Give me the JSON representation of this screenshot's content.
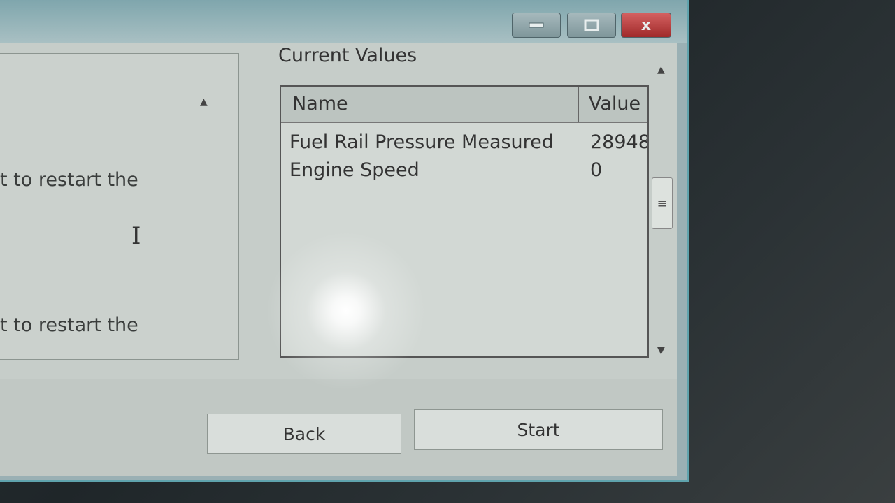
{
  "window": {
    "controls": {
      "minimize_icon": "minimize-icon",
      "maximize_icon": "maximize-icon",
      "close_label": "x"
    }
  },
  "left_panel": {
    "lines": [
      "t to restart the",
      "t to restart the"
    ]
  },
  "current_values": {
    "title": "Current Values",
    "columns": [
      "Name",
      "Value"
    ],
    "rows": [
      {
        "name": "Fuel Rail Pressure Measured",
        "value": "28948"
      },
      {
        "name": "Engine Speed",
        "value": "0"
      }
    ]
  },
  "buttons": {
    "back": "Back",
    "start": "Start"
  }
}
